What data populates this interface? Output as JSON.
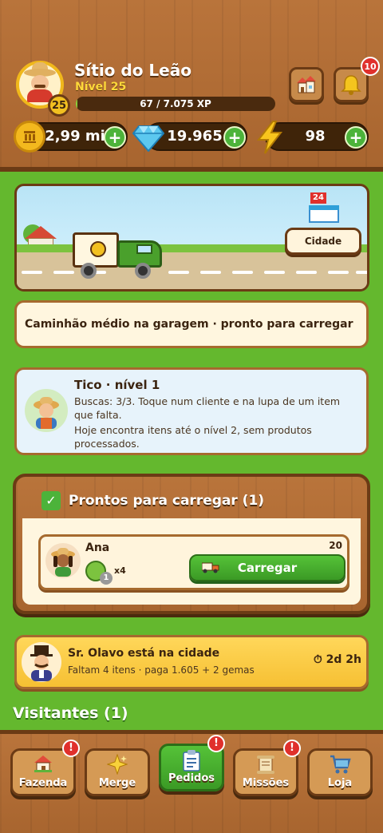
{
  "header": {
    "farm_name": "Sítio do Leão",
    "level_text": "Nível 25",
    "level_badge": "25",
    "xp_text": "67 / 7.075 XP",
    "xp_progress": 0.0095,
    "notifications": "10"
  },
  "resources": {
    "coins": "2,99 mi",
    "gems": "19.965",
    "energy": "98",
    "plus": "+"
  },
  "scene": {
    "shop_sign": "24",
    "city_button": "Cidade"
  },
  "status": {
    "text": "Caminhão médio na garagem · pronto para carregar"
  },
  "helper": {
    "title": "Tico · nível 1",
    "line1": "Buscas: 3/3. Toque num cliente e na lupa de um item que falta.",
    "line2": "Hoje encontra itens até o nível 2, sem produtos processados."
  },
  "ready": {
    "title": "Prontos para carregar (1)",
    "check": "✓",
    "order": {
      "customer": "Ana",
      "quantity": "20",
      "item_level": "1",
      "item_multiplier": "x4",
      "button": "Carregar"
    }
  },
  "visitor": {
    "title": "Sr. Olavo está na cidade",
    "subtitle": "Faltam 4 itens · paga 1.605 + 2 gemas",
    "timer": "2d 2h"
  },
  "visitors_label": "Visitantes (1)",
  "nav": {
    "items": [
      {
        "label": "Fazenda",
        "icon": "house-icon",
        "alert": "!"
      },
      {
        "label": "Merge",
        "icon": "sparkles-icon",
        "alert": ""
      },
      {
        "label": "Pedidos",
        "icon": "clipboard-icon",
        "alert": "!"
      },
      {
        "label": "Missões",
        "icon": "scroll-icon",
        "alert": "!"
      },
      {
        "label": "Loja",
        "icon": "cart-icon",
        "alert": ""
      }
    ]
  },
  "colors": {
    "background": "#64b82e",
    "wood": "#b9743b",
    "accent_green": "#4cb33a",
    "alert_red": "#e0302c"
  }
}
